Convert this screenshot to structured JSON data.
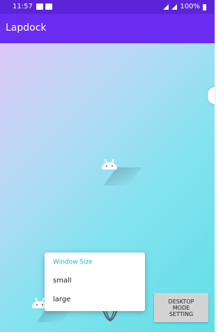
{
  "status_bar": {
    "time": "11:57",
    "icons_right": "100%"
  },
  "app_bar": {
    "title": "Lapdock"
  },
  "popup": {
    "header": "Window Size",
    "items": [
      "small",
      "large"
    ]
  },
  "desktop_button": {
    "lines": [
      "DESKTOP",
      "MODE",
      "SETTING"
    ]
  }
}
